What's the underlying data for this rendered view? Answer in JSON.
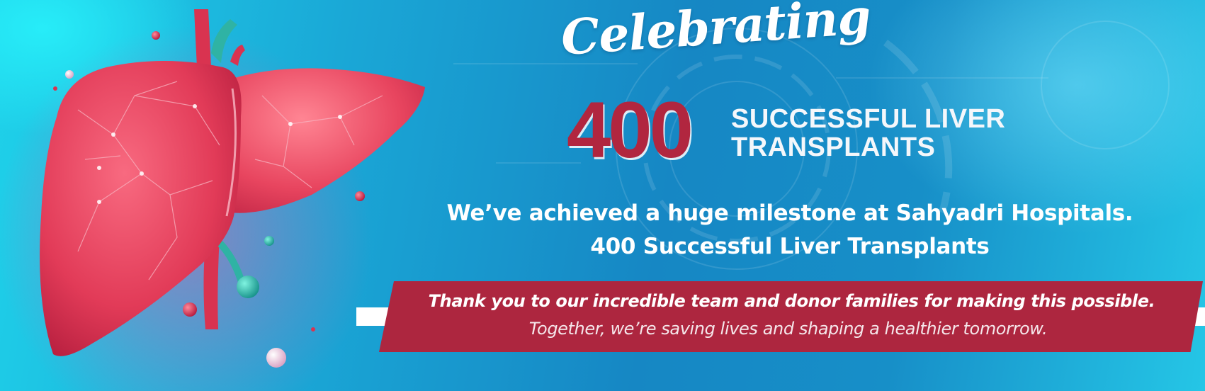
{
  "banner": {
    "script_word": "Celebrating",
    "number": "400",
    "headline_line1": "SUCCESSFUL LIVER",
    "headline_line2": "TRANSPLANTS",
    "subtext_line1": "We’ve achieved a huge milestone at Sahyadri Hospitals.",
    "subtext_line2": "400 Successful Liver Transplants",
    "ribbon_line1": "Thank you to our incredible team and donor families for making this possible.",
    "ribbon_line2": "Together, we’re saving lives and shaping a healthier tomorrow."
  },
  "icons": {
    "illustration": "liver-illustration-icon",
    "background": "tech-rings-decoration"
  },
  "colors": {
    "accent_red": "#ad263f",
    "number_red": "#b1263f",
    "background_blue": "#1687c4",
    "background_cyan": "#1fd2ea",
    "liver_red": "#e8435e",
    "text_white": "#ffffff"
  }
}
